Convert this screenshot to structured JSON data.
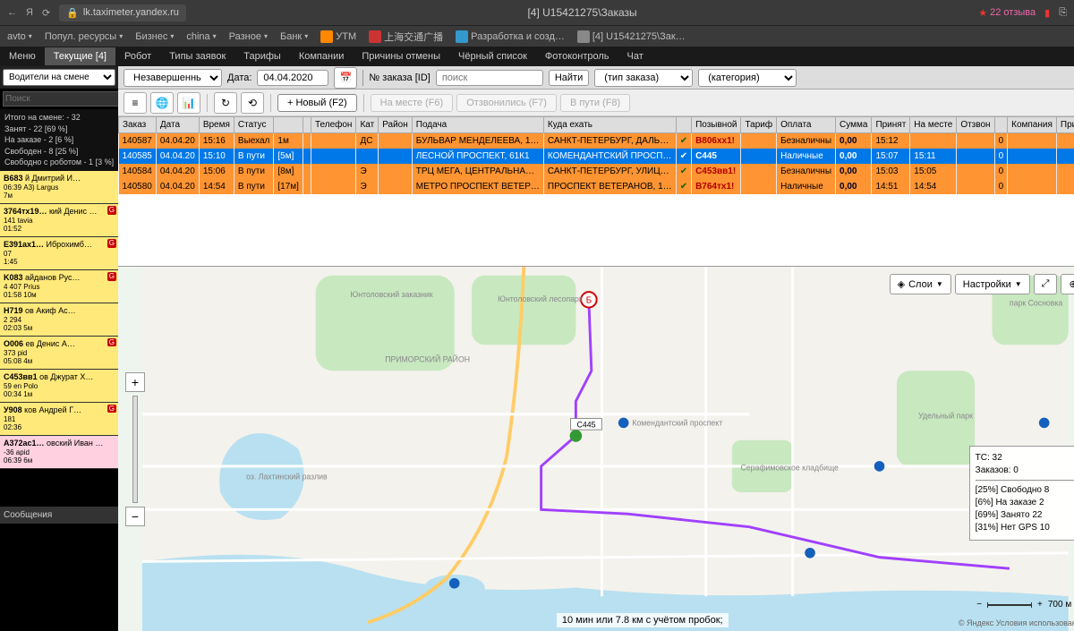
{
  "browser": {
    "url_host": "lk.taximeter.yandex.ru",
    "tab_title": "[4] U15421275\\Заказы",
    "reviews": "22 отзыва"
  },
  "bookmarks": [
    "avto",
    "Попул. ресурсы",
    "Бизнес",
    "china",
    "Разное",
    "Банк",
    "УТМ",
    "上海交通广播",
    "Разработка и созд…",
    "[4] U15421275\\Зак…"
  ],
  "menu": {
    "items": [
      "Меню",
      "Текущие [4]",
      "Робот",
      "Типы заявок",
      "Тарифы",
      "Компании",
      "Причины отмены",
      "Чёрный список",
      "Фотоконтроль",
      "Чат"
    ],
    "active_index": 1
  },
  "sidebar": {
    "filter_label": "Водители на смене",
    "search_placeholder": "Поиск",
    "stats": [
      "Итого на смене: - 32",
      "Занят - 22 [69 %]",
      "На заказе - 2 [6 %]",
      "Свободен - 8 [25 %]",
      "Свободно с роботом - 1 [3 %]"
    ],
    "drivers": [
      {
        "code": "B683",
        "name": "й Дмитрий И…",
        "sub": "А3) Largus",
        "t1": "06:39",
        "t2": "7м",
        "cls": "yellow"
      },
      {
        "code": "3764тх19…",
        "name": "кий Денис …",
        "sub": "tavia",
        "t1": "141",
        "t2": "01:52",
        "cls": "yellow",
        "g": true
      },
      {
        "code": "E391ax1…",
        "name": "Иброхимб…",
        "sub": "",
        "t1": "07",
        "t2": "1:45",
        "cls": "yellow",
        "g": true
      },
      {
        "code": "K083",
        "name": "айданов Рус…",
        "sub": "Prius",
        "t1": "4 407",
        "t2": "01:58",
        "t3": "10м",
        "cls": "yellow",
        "g": true
      },
      {
        "code": "H719",
        "name": "ов Акиф Ас…",
        "sub": "",
        "t1": "2 294",
        "t2": "02:03",
        "t3": "5м",
        "cls": "yellow"
      },
      {
        "code": "O006",
        "name": "ев Денис А…",
        "sub": "pid",
        "t1": "373",
        "t2": "05:08",
        "t3": "4м",
        "cls": "yellow",
        "g": true
      },
      {
        "code": "C453вв1",
        "name": "ов Джурат Х…",
        "sub": "en Polo",
        "t1": "59",
        "t2": "00:34",
        "t3": "1м",
        "cls": "yellow"
      },
      {
        "code": "У908",
        "name": "ков Андрей Г…",
        "sub": "",
        "t1": "181",
        "t2": "02:36",
        "cls": "yellow",
        "g": true
      },
      {
        "code": "A372ac1…",
        "name": "овский Иван …",
        "sub": "apid",
        "t1": "-36",
        "t2": "06:39",
        "t3": "6м",
        "cls": "pink"
      }
    ],
    "messages_label": "Сообщения"
  },
  "filters": {
    "status": "Незавершенные",
    "date_label": "Дата:",
    "date": "04.04.2020",
    "order_label": "№ заказа [ID]",
    "search_placeholder": "поиск",
    "find_btn": "Найти",
    "type": "(тип заказа)",
    "category": "(категория)"
  },
  "iconbar": {
    "new_btn": "+ Новый (F2)",
    "disabled": [
      "На месте (F6)",
      "Отзвонились (F7)",
      "В пути (F8)"
    ]
  },
  "orders": {
    "headers": [
      "Заказ",
      "Дата",
      "Время",
      "Статус",
      "",
      "",
      "Телефон",
      "Кат",
      "Район",
      "Подача",
      "Куда ехать",
      "",
      "Позывной",
      "Тариф",
      "Оплата",
      "Сумма",
      "Принят",
      "На месте",
      "Отзвон",
      "",
      "Компания",
      "Приме"
    ],
    "rows": [
      {
        "cls": "orange",
        "cells": [
          "140587",
          "04.04.20",
          "15:16",
          "Выехал",
          "1м",
          "",
          "",
          "ДС",
          "",
          "БУЛЬВАР МЕНДЕЛЕЕВА, 1…",
          "САНКТ-ПЕТЕРБУРГ, ДАЛЬ…",
          "✓",
          "B806xx1!",
          "",
          "Безналичны",
          "0,00",
          "15:12",
          "",
          "",
          "0",
          "",
          ""
        ]
      },
      {
        "cls": "blue",
        "cells": [
          "140585",
          "04.04.20",
          "15:10",
          "В пути",
          "[5м]",
          "",
          "",
          "",
          "",
          "ЛЕСНОЙ ПРОСПЕКТ, 61К1",
          "КОМЕНДАНТСКИЙ ПРОСП…",
          "✓",
          "C445",
          "",
          "Наличные",
          "0,00",
          "15:07",
          "15:11",
          "",
          "0",
          "",
          ""
        ]
      },
      {
        "cls": "orange",
        "cells": [
          "140584",
          "04.04.20",
          "15:06",
          "В пути",
          "[8м]",
          "",
          "",
          "Э",
          "",
          "ТРЦ МЕГА, ЦЕНТРАЛЬНА…",
          "САНКТ-ПЕТЕРБУРГ, УЛИЦ…",
          "✓",
          "C453вв1!",
          "",
          "Безналичны",
          "0,00",
          "15:03",
          "15:05",
          "",
          "0",
          "",
          ""
        ]
      },
      {
        "cls": "orange",
        "cells": [
          "140580",
          "04.04.20",
          "14:54",
          "В пути",
          "[17м]",
          "",
          "",
          "Э",
          "",
          "МЕТРО ПРОСПЕКТ ВЕТЕР…",
          "ПРОСПЕКТ ВЕТЕРАНОВ, 1…",
          "✓",
          "B764тх1!",
          "",
          "Наличные",
          "0,00",
          "14:51",
          "14:54",
          "",
          "0",
          "",
          ""
        ]
      }
    ]
  },
  "map": {
    "layers_btn": "Слои",
    "settings_btn": "Настройки",
    "stats": {
      "tc": "ТС: 32",
      "orders": "Заказов: 0",
      "rows": [
        "[25%]  Свободно  8",
        "[6%]   На заказе  2",
        "[69%]  Занято  22",
        "[31%]  Нет GPS  10"
      ]
    },
    "route_info": "10 мин или 7.8 км с учётом пробок;",
    "scale": "700 м",
    "footer": "© Яндекс  Условия использования",
    "yandex": "Яндекс",
    "labels": {
      "primorsky": "ПРИМОРСКИЙ РАЙОН",
      "yuntol_les": "Юнтоловский лесопарк",
      "yuntol_zak": "Юнтоловский заказник",
      "lakht": "оз. Лахтинский разлив",
      "komend": "Комендантский проспект",
      "sosnovka": "парк Сосновка",
      "udelny": "Удельный парк",
      "serafim": "Серафимовское кладбище"
    }
  }
}
